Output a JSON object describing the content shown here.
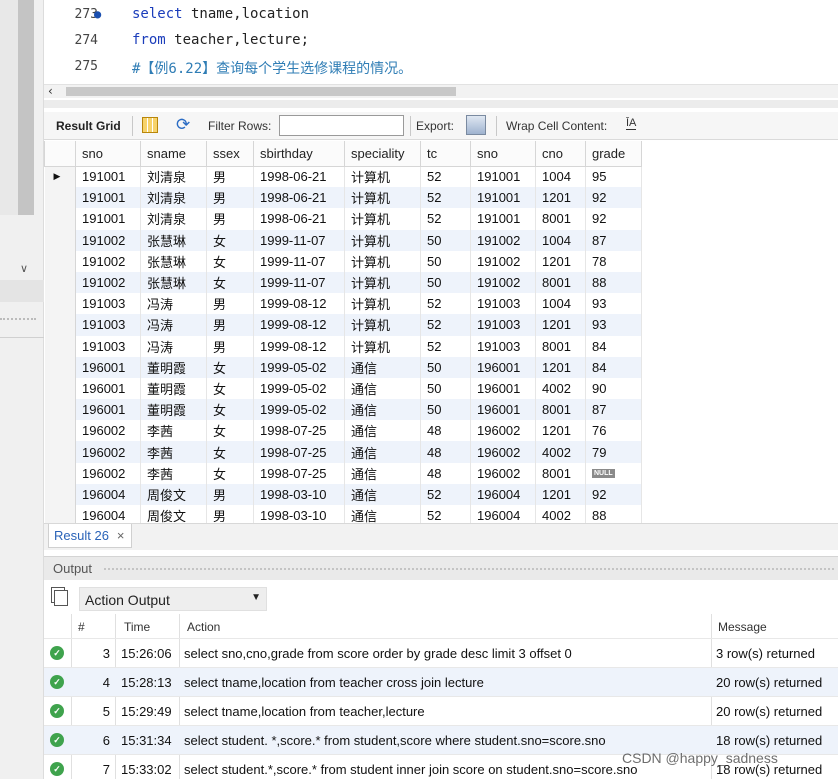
{
  "editor": {
    "lines": [
      {
        "num": "273",
        "kw1": "select",
        "rest1": " tname,location",
        "kw2": "",
        "rest2": ""
      },
      {
        "num": "274",
        "kw1": "from",
        "rest1": " teacher,lecture;",
        "kw2": "",
        "rest2": ""
      },
      {
        "num": "275",
        "comment": "#【例6.22】查询每个学生选修课程的情况。"
      }
    ]
  },
  "toolbar": {
    "result_grid": "Result Grid",
    "filter_rows": "Filter Rows:",
    "filter_value": "",
    "export": "Export:",
    "wrap_cell": "Wrap Cell Content:",
    "wrap_icon": "ĪA"
  },
  "grid": {
    "columns": [
      "sno",
      "sname",
      "ssex",
      "sbirthday",
      "speciality",
      "tc",
      "sno",
      "cno",
      "grade"
    ],
    "rows": [
      [
        "191001",
        "刘清泉",
        "男",
        "1998-06-21",
        "计算机",
        "52",
        "191001",
        "1004",
        "95"
      ],
      [
        "191001",
        "刘清泉",
        "男",
        "1998-06-21",
        "计算机",
        "52",
        "191001",
        "1201",
        "92"
      ],
      [
        "191001",
        "刘清泉",
        "男",
        "1998-06-21",
        "计算机",
        "52",
        "191001",
        "8001",
        "92"
      ],
      [
        "191002",
        "张慧琳",
        "女",
        "1999-11-07",
        "计算机",
        "50",
        "191002",
        "1004",
        "87"
      ],
      [
        "191002",
        "张慧琳",
        "女",
        "1999-11-07",
        "计算机",
        "50",
        "191002",
        "1201",
        "78"
      ],
      [
        "191002",
        "张慧琳",
        "女",
        "1999-11-07",
        "计算机",
        "50",
        "191002",
        "8001",
        "88"
      ],
      [
        "191003",
        "冯涛",
        "男",
        "1999-08-12",
        "计算机",
        "52",
        "191003",
        "1004",
        "93"
      ],
      [
        "191003",
        "冯涛",
        "男",
        "1999-08-12",
        "计算机",
        "52",
        "191003",
        "1201",
        "93"
      ],
      [
        "191003",
        "冯涛",
        "男",
        "1999-08-12",
        "计算机",
        "52",
        "191003",
        "8001",
        "84"
      ],
      [
        "196001",
        "董明霞",
        "女",
        "1999-05-02",
        "通信",
        "50",
        "196001",
        "1201",
        "84"
      ],
      [
        "196001",
        "董明霞",
        "女",
        "1999-05-02",
        "通信",
        "50",
        "196001",
        "4002",
        "90"
      ],
      [
        "196001",
        "董明霞",
        "女",
        "1999-05-02",
        "通信",
        "50",
        "196001",
        "8001",
        "87"
      ],
      [
        "196002",
        "李茜",
        "女",
        "1998-07-25",
        "通信",
        "48",
        "196002",
        "1201",
        "76"
      ],
      [
        "196002",
        "李茜",
        "女",
        "1998-07-25",
        "通信",
        "48",
        "196002",
        "4002",
        "79"
      ],
      [
        "196002",
        "李茜",
        "女",
        "1998-07-25",
        "通信",
        "48",
        "196002",
        "8001",
        "NULL"
      ],
      [
        "196004",
        "周俊文",
        "男",
        "1998-03-10",
        "通信",
        "52",
        "196004",
        "1201",
        "92"
      ],
      [
        "196004",
        "周俊文",
        "男",
        "1998-03-10",
        "通信",
        "52",
        "196004",
        "4002",
        "88"
      ]
    ]
  },
  "result_tab": {
    "label": "Result 26",
    "close": "×"
  },
  "output": {
    "title": "Output",
    "select_label": "Action Output",
    "headers": {
      "num": "#",
      "time": "Time",
      "action": "Action",
      "message": "Message"
    },
    "rows": [
      {
        "num": "3",
        "time": "15:26:06",
        "action": "select sno,cno,grade from score order by grade desc limit 3 offset 0",
        "message": "3 row(s) returned"
      },
      {
        "num": "4",
        "time": "15:28:13",
        "action": "select tname,location from teacher cross join lecture",
        "message": "20 row(s) returned"
      },
      {
        "num": "5",
        "time": "15:29:49",
        "action": "select tname,location  from teacher,lecture",
        "message": "20 row(s) returned"
      },
      {
        "num": "6",
        "time": "15:31:34",
        "action": "select student. *,score.* from student,score where student.sno=score.sno",
        "message": "18 row(s) returned"
      },
      {
        "num": "7",
        "time": "15:33:02",
        "action": "select student.*,score.* from student inner join score on student.sno=score.sno",
        "message": "18 row(s) returned"
      }
    ]
  },
  "watermark": "CSDN @happy_sadness",
  "colors": {
    "keyword": "#1b3dbb",
    "comment": "#2f7db5",
    "accent": "#2a63b8",
    "success": "#3fa34d",
    "alt_row": "#eef3fb"
  }
}
